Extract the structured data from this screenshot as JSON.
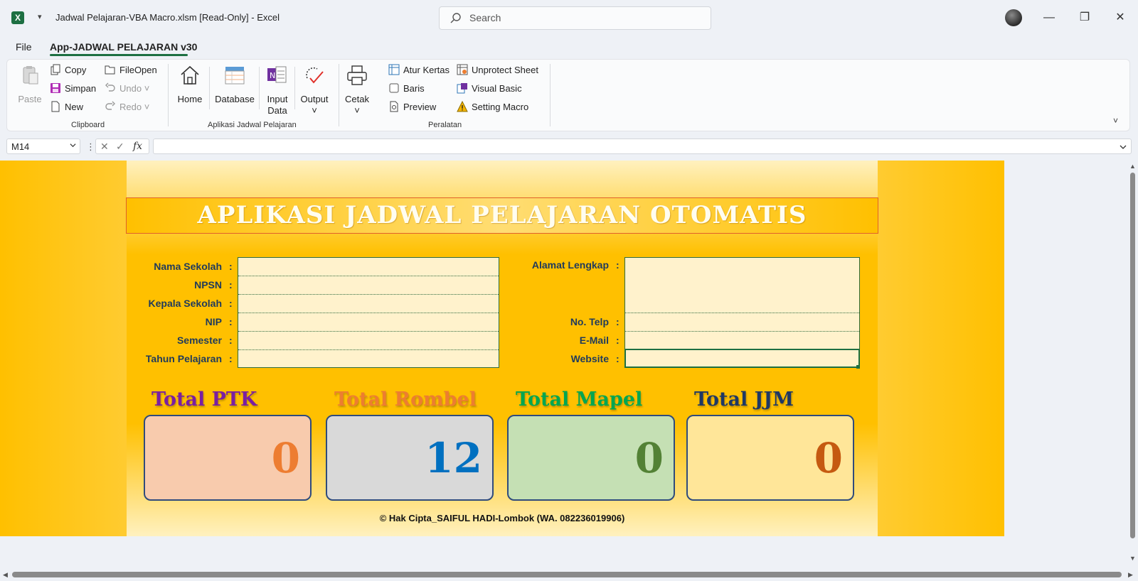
{
  "window": {
    "title": "Jadwal Pelajaran-VBA Macro.xlsm  [Read-Only]  -  Excel",
    "search_placeholder": "Search",
    "app_icon_letter": "X"
  },
  "tabs": {
    "file": "File",
    "active": "App-JADWAL PELAJARAN v30"
  },
  "ribbon": {
    "clipboard": {
      "paste": "Paste",
      "copy": "Copy",
      "simpan": "Simpan",
      "new": "New",
      "fileopen": "FileOpen",
      "undo": "Undo",
      "redo": "Redo",
      "label": "Clipboard"
    },
    "aplikasi": {
      "home": "Home",
      "database": "Database",
      "input_data_1": "Input",
      "input_data_2": "Data",
      "output": "Output",
      "label": "Aplikasi Jadwal Pelajaran"
    },
    "peralatan": {
      "cetak": "Cetak",
      "atur_kertas": "Atur Kertas",
      "baris": "Baris",
      "preview": "Preview",
      "unprotect": "Unprotect Sheet",
      "visual_basic": "Visual Basic",
      "setting_macro": "Setting Macro",
      "label": "Peralatan"
    }
  },
  "formula_bar": {
    "name_box": "M14",
    "fx": "fx",
    "value": ""
  },
  "sheet": {
    "title": "APLIKASI JADWAL PELAJARAN OTOMATIS",
    "left_fields": [
      {
        "label": "Nama Sekolah",
        "value": ""
      },
      {
        "label": "NPSN",
        "value": ""
      },
      {
        "label": "Kepala Sekolah",
        "value": ""
      },
      {
        "label": "NIP",
        "value": ""
      },
      {
        "label": "Semester",
        "value": ""
      },
      {
        "label": "Tahun Pelajaran",
        "value": ""
      }
    ],
    "right_fields": [
      {
        "label": "Alamat Lengkap",
        "value": ""
      },
      {
        "label": "No. Telp",
        "value": ""
      },
      {
        "label": "E-Mail",
        "value": ""
      },
      {
        "label": "Website",
        "value": ""
      }
    ],
    "colon": ":",
    "stats": [
      {
        "label": "Total PTK",
        "value": "0",
        "label_color": "#7a1fa2",
        "value_color": "#ed7d31",
        "bg": "#f8cbad"
      },
      {
        "label": "Total Rombel",
        "value": "12",
        "label_color": "#ed7d31",
        "value_color": "#0070c0",
        "bg": "#d9d9d9"
      },
      {
        "label": "Total Mapel",
        "value": "0",
        "label_color": "#00a651",
        "value_color": "#538135",
        "bg": "#c5e0b4"
      },
      {
        "label": "Total JJM",
        "value": "0",
        "label_color": "#1f3864",
        "value_color": "#c55a11",
        "bg": "#ffe699"
      }
    ],
    "copyright": "© Hak Cipta_SAIFUL HADI-Lombok (WA. 082236019906)"
  }
}
